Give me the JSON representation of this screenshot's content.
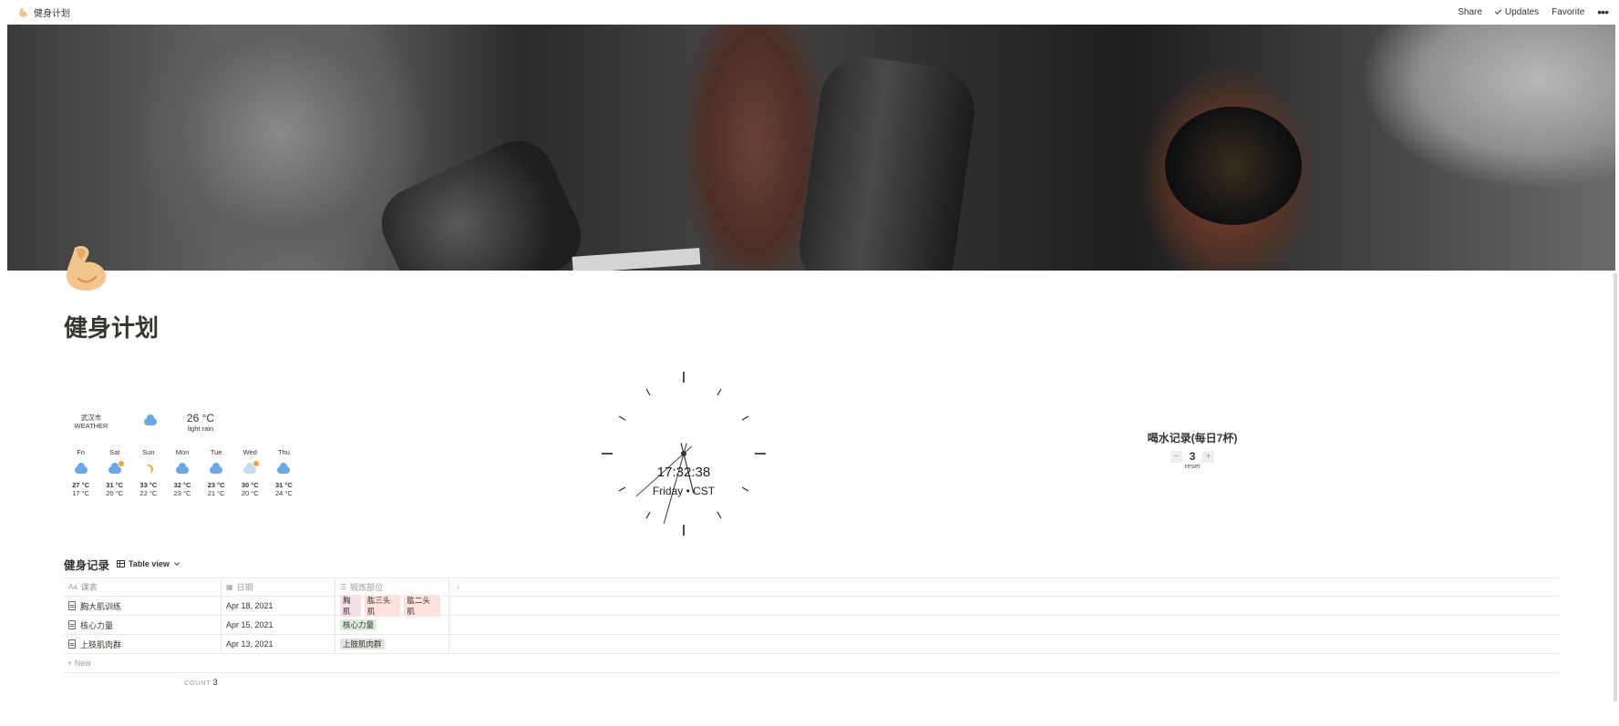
{
  "topbar": {
    "breadcrumb": "健身计划",
    "share": "Share",
    "updates": "Updates",
    "favorite": "Favorite",
    "more": "•••"
  },
  "page": {
    "title": "健身计划"
  },
  "weather": {
    "city": "武汉市",
    "label": "WEATHER",
    "temp": "26 °C",
    "desc": "light rain",
    "days": [
      {
        "name": "Fri",
        "icon": "rain-cloud-icon",
        "hi": "27 °C",
        "lo": "17 °C"
      },
      {
        "name": "Sat",
        "icon": "partly-cloudy-icon",
        "hi": "31 °C",
        "lo": "20 °C"
      },
      {
        "name": "Sun",
        "icon": "moon-icon",
        "hi": "33 °C",
        "lo": "22 °C"
      },
      {
        "name": "Mon",
        "icon": "rain-cloud-icon",
        "hi": "32 °C",
        "lo": "23 °C"
      },
      {
        "name": "Tue",
        "icon": "rain-cloud-icon",
        "hi": "23 °C",
        "lo": "21 °C"
      },
      {
        "name": "Wed",
        "icon": "sunny-cloud-icon",
        "hi": "30 °C",
        "lo": "20 °C"
      },
      {
        "name": "Thu",
        "icon": "rain-cloud-icon",
        "hi": "31 °C",
        "lo": "24 °C"
      }
    ]
  },
  "clock": {
    "time": "17:32:38",
    "zone": "Friday • CST",
    "hour": 17,
    "minute": 32,
    "second": 38
  },
  "water": {
    "title": "喝水记录(每日7杯)",
    "minus": "−",
    "plus": "+",
    "value": "3",
    "reset": "reset"
  },
  "database": {
    "name": "健身记录",
    "view": "Table view",
    "columns": {
      "title": "课表",
      "date": "日期",
      "parts": "锻炼部位"
    },
    "rows": [
      {
        "title": "胸大肌训练",
        "date": "Apr 18, 2021",
        "tags": [
          {
            "label": "胸肌",
            "color": "pink"
          },
          {
            "label": "肱三头肌",
            "color": "red"
          },
          {
            "label": "肱二头肌",
            "color": "red"
          }
        ]
      },
      {
        "title": "核心力量",
        "date": "Apr 15, 2021",
        "tags": [
          {
            "label": "核心力量",
            "color": "green"
          }
        ]
      },
      {
        "title": "上肢肌肉群",
        "date": "Apr 13, 2021",
        "tags": [
          {
            "label": "上肢肌肉群",
            "color": "gray"
          }
        ]
      }
    ],
    "new_label": "+ New",
    "count_label": "COUNT",
    "count_value": "3"
  }
}
